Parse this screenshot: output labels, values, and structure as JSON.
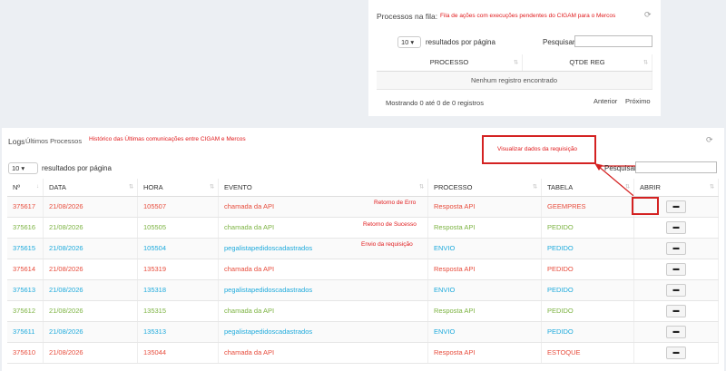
{
  "queue": {
    "title": "Processos na fila:",
    "annotation": "Fila de ações com execuções pendentes do CIGAM para o Mercos",
    "page_size": "10",
    "page_size_suffix": "resultados por página",
    "search_label": "Pesquisar",
    "columns": [
      "PROCESSO",
      "QTDE REG"
    ],
    "empty": "Nenhum registro encontrado",
    "info": "Mostrando 0 até 0 de 0 registros",
    "prev": "Anterior",
    "next": "Próximo"
  },
  "logs": {
    "title": "Logs",
    "subtitle": "Últimos Processos",
    "annotation": "Histórico das Últimas comunicações entre CIGAM e Mercos",
    "callout": "Visualizar dados da requisição",
    "page_size": "10",
    "page_size_suffix": "resultados por página",
    "search_label": "Pesquisar",
    "columns": [
      "Nº",
      "DATA",
      "HORA",
      "EVENTO",
      "PROCESSO",
      "TABELA",
      "ABRIR"
    ],
    "row_notes": [
      "Retorno de Erro",
      "Retorno de Sucesso",
      "Envio da requisição"
    ],
    "rows": [
      {
        "n": "375617",
        "data": "21/08/2026",
        "hora": "105507",
        "evento": "chamada da API",
        "processo": "Resposta API",
        "tabela": "GEEMPRES",
        "status": "error"
      },
      {
        "n": "375616",
        "data": "21/08/2026",
        "hora": "105505",
        "evento": "chamada da API",
        "processo": "Resposta API",
        "tabela": "PEDIDO",
        "status": "success"
      },
      {
        "n": "375615",
        "data": "21/08/2026",
        "hora": "105504",
        "evento": "pegalistapedidoscadastrados",
        "processo": "ENVIO",
        "tabela": "PEDIDO",
        "status": "send"
      },
      {
        "n": "375614",
        "data": "21/08/2026",
        "hora": "135319",
        "evento": "chamada da API",
        "processo": "Resposta API",
        "tabela": "PEDIDO",
        "status": "error"
      },
      {
        "n": "375613",
        "data": "21/08/2026",
        "hora": "135318",
        "evento": "pegalistapedidoscadastrados",
        "processo": "ENVIO",
        "tabela": "PEDIDO",
        "status": "send"
      },
      {
        "n": "375612",
        "data": "21/08/2026",
        "hora": "135315",
        "evento": "chamada da API",
        "processo": "Resposta API",
        "tabela": "PEDIDO",
        "status": "success"
      },
      {
        "n": "375611",
        "data": "21/08/2026",
        "hora": "135313",
        "evento": "pegalistapedidoscadastrados",
        "processo": "ENVIO",
        "tabela": "PEDIDO",
        "status": "send"
      },
      {
        "n": "375610",
        "data": "21/08/2026",
        "hora": "135044",
        "evento": "chamada da API",
        "processo": "Resposta API",
        "tabela": "ESTOQUE",
        "status": "error"
      }
    ]
  },
  "colors": {
    "error": "#e74c3c",
    "success": "#7cb342",
    "send": "#1eaadc",
    "annotation": "#e0191b"
  },
  "icons": {
    "refresh": "refresh-icon",
    "open": "folder-open-icon",
    "sort": "sort-icon"
  }
}
